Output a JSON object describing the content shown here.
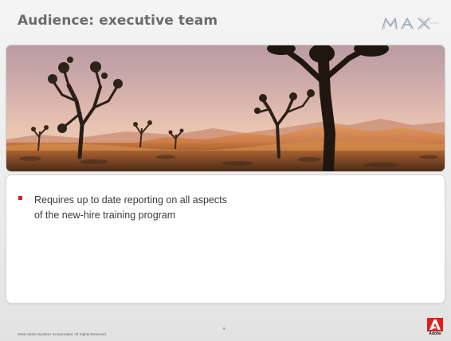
{
  "slide": {
    "title": "Audience: executive team",
    "brand_logo": "MAX",
    "bullets": [
      "Requires up to date reporting on all aspects of the new-hire training program"
    ],
    "footer": {
      "copyright": "2006 Adobe Systems Incorporated.  All Rights Reserved.",
      "page_number": "9",
      "adobe_label": "Adobe"
    }
  },
  "colors": {
    "title": "#6a6a6a",
    "bullet_marker": "#d0231f",
    "adobe_red": "#e21d1d"
  },
  "icons": {
    "max_logo": "max-logo",
    "adobe_logo": "adobe-logo"
  }
}
